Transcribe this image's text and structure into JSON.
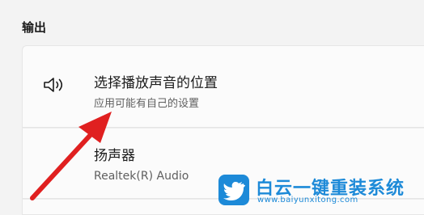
{
  "section": {
    "heading": "输出"
  },
  "output_location": {
    "icon": "speaker-icon",
    "title": "选择播放声音的位置",
    "subtitle": "应用可能有自己的设置"
  },
  "device": {
    "name": "扬声器",
    "detail": "Realtek(R) Audio"
  },
  "annotation": {
    "arrow_color": "#e02020"
  },
  "watermark": {
    "brand": "白云一键重装系统",
    "url": "www.baiyunxitong.com",
    "color": "#1d8ad8"
  }
}
